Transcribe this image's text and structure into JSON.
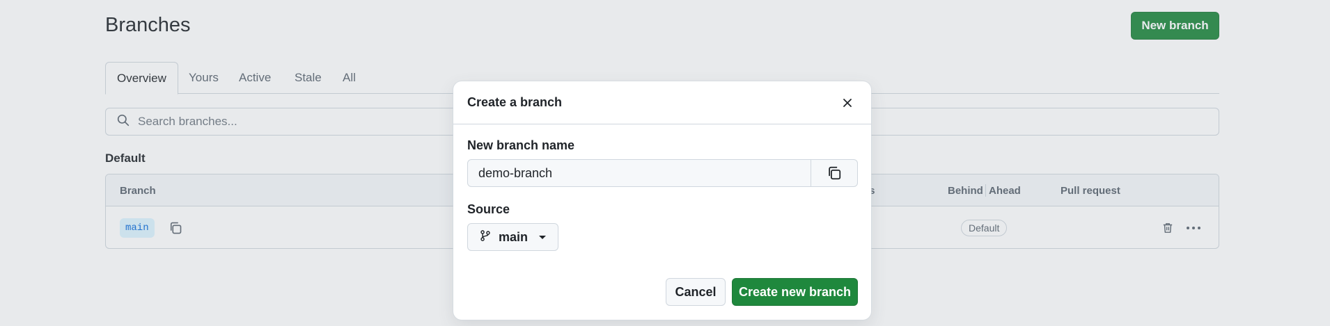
{
  "page": {
    "title": "Branches",
    "new_branch_label": "New branch",
    "tabs": [
      {
        "label": "Overview",
        "selected": true
      },
      {
        "label": "Yours",
        "selected": false
      },
      {
        "label": "Active",
        "selected": false
      },
      {
        "label": "Stale",
        "selected": false
      },
      {
        "label": "All",
        "selected": false
      }
    ],
    "search": {
      "placeholder": "Search branches...",
      "value": ""
    },
    "section_title": "Default",
    "table": {
      "columns": [
        "Branch",
        "us",
        "Behind",
        "Ahead",
        "Pull request"
      ],
      "rows": [
        {
          "branch": "main",
          "badge": "Default"
        }
      ]
    }
  },
  "dialog": {
    "title": "Create a branch",
    "name_label": "New branch name",
    "name_value": "demo-branch",
    "source_label": "Source",
    "source_value": "main",
    "cancel_label": "Cancel",
    "create_label": "Create new branch"
  },
  "icons": {
    "search": "search-icon",
    "copy": "copy-icon",
    "trash": "trash-icon",
    "more": "kebab-horizontal-icon",
    "close": "close-icon",
    "branch": "git-branch-icon",
    "caret": "triangle-down-icon"
  },
  "colors": {
    "primary_green": "#1f883d",
    "branch_chip_bg": "#ddf4ff",
    "branch_chip_text": "#0969da",
    "border": "#d0d7de",
    "muted_text": "#59636e",
    "overlay": "rgba(140,149,159,0.2)"
  }
}
